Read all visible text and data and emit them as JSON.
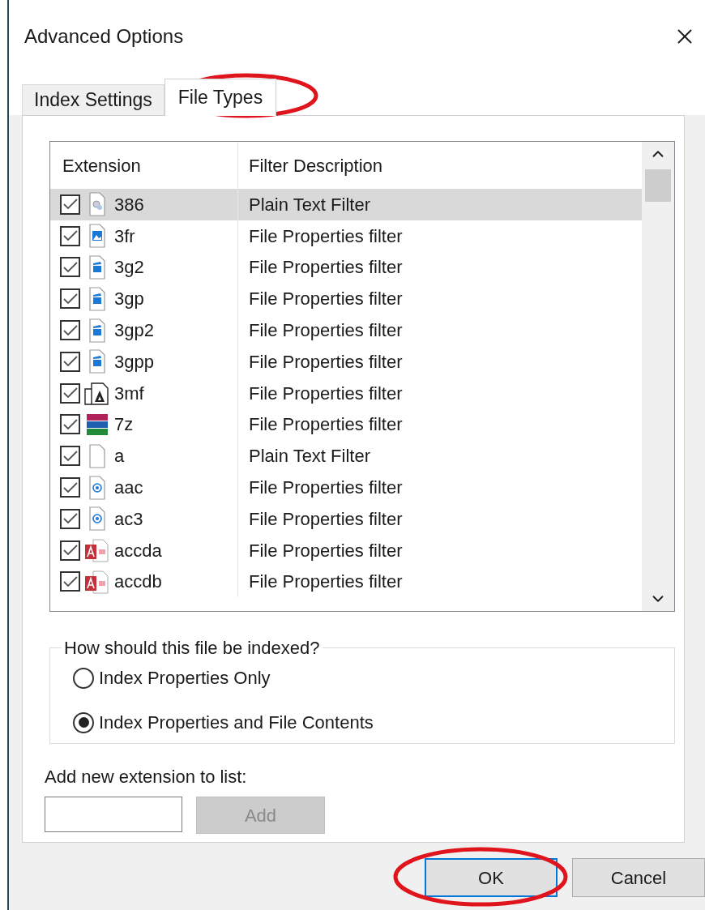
{
  "window": {
    "title": "Advanced Options"
  },
  "tabs": [
    {
      "label": "Index Settings",
      "selected": false
    },
    {
      "label": "File Types",
      "selected": true
    }
  ],
  "table": {
    "columns": [
      "Extension",
      "Filter Description"
    ],
    "rows": [
      {
        "extension": "386",
        "filter": "Plain Text Filter",
        "checked": true,
        "selected": true,
        "kind": "gear"
      },
      {
        "extension": "3fr",
        "filter": "File Properties filter",
        "checked": true,
        "selected": false,
        "kind": "image"
      },
      {
        "extension": "3g2",
        "filter": "File Properties filter",
        "checked": true,
        "selected": false,
        "kind": "video"
      },
      {
        "extension": "3gp",
        "filter": "File Properties filter",
        "checked": true,
        "selected": false,
        "kind": "video"
      },
      {
        "extension": "3gp2",
        "filter": "File Properties filter",
        "checked": true,
        "selected": false,
        "kind": "video"
      },
      {
        "extension": "3gpp",
        "filter": "File Properties filter",
        "checked": true,
        "selected": false,
        "kind": "video"
      },
      {
        "extension": "3mf",
        "filter": "File Properties filter",
        "checked": true,
        "selected": false,
        "kind": "model"
      },
      {
        "extension": "7z",
        "filter": "File Properties filter",
        "checked": true,
        "selected": false,
        "kind": "archive"
      },
      {
        "extension": "a",
        "filter": "Plain Text Filter",
        "checked": true,
        "selected": false,
        "kind": "blank"
      },
      {
        "extension": "aac",
        "filter": "File Properties filter",
        "checked": true,
        "selected": false,
        "kind": "audio"
      },
      {
        "extension": "ac3",
        "filter": "File Properties filter",
        "checked": true,
        "selected": false,
        "kind": "audio"
      },
      {
        "extension": "accda",
        "filter": "File Properties filter",
        "checked": true,
        "selected": false,
        "kind": "access"
      },
      {
        "extension": "accdb",
        "filter": "File Properties filter",
        "checked": true,
        "selected": false,
        "kind": "access"
      }
    ]
  },
  "index_group": {
    "title": "How should this file be indexed?",
    "options": [
      {
        "label": "Index Properties Only",
        "selected": false
      },
      {
        "label": "Index Properties and File Contents",
        "selected": true
      }
    ]
  },
  "add_extension": {
    "label": "Add new extension to list:",
    "button": {
      "label": "Add",
      "disabled": true
    }
  },
  "buttons": [
    {
      "label": "OK",
      "default": true
    },
    {
      "label": "Cancel",
      "default": false
    }
  ]
}
